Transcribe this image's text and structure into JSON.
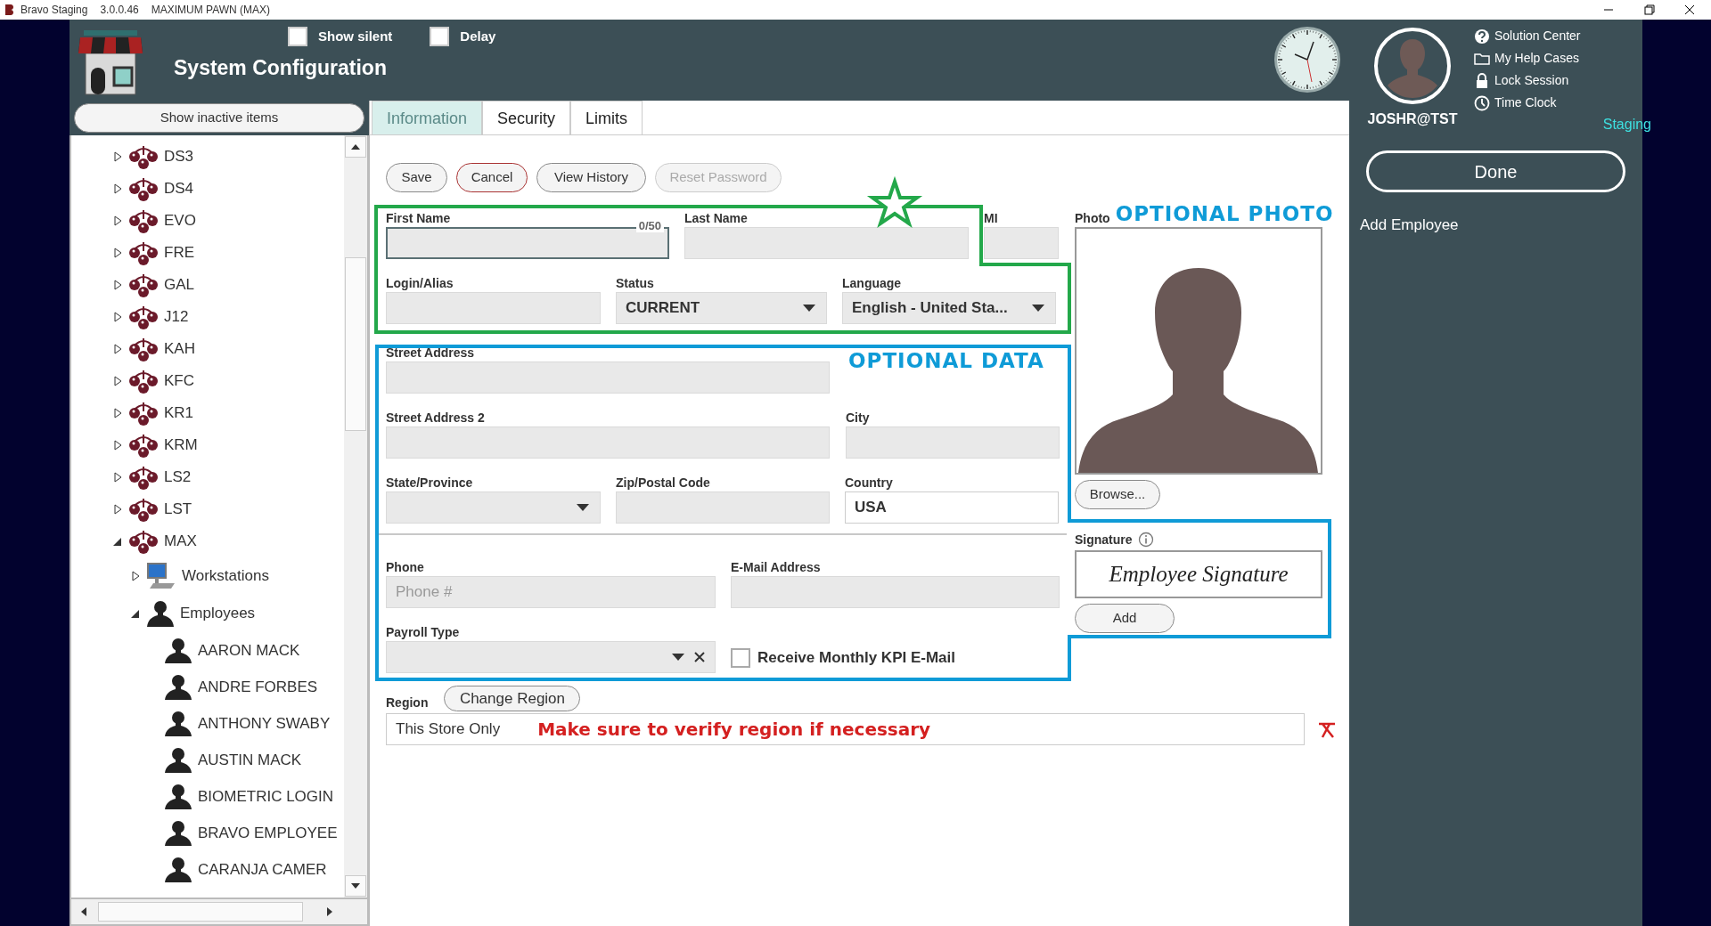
{
  "title_bar": {
    "app": "Bravo Staging",
    "version": "3.0.0.46",
    "store": "MAXIMUM PAWN (MAX)"
  },
  "header": {
    "title": "System Configuration",
    "options": [
      {
        "label": "Show silent",
        "checked": false
      },
      {
        "label": "Delay",
        "checked": false
      }
    ]
  },
  "user": {
    "name": "JOSHR@TST",
    "environment": "Staging",
    "links": [
      {
        "label": "Solution Center",
        "kind": "help"
      },
      {
        "label": "My Help Cases",
        "kind": "folder"
      },
      {
        "label": "Lock Session",
        "kind": "lock"
      },
      {
        "label": "Time Clock",
        "kind": "clock"
      }
    ]
  },
  "right_panel": {
    "done": "Done",
    "context": "Add Employee"
  },
  "sidebar": {
    "toggle": "Show inactive items",
    "tree": [
      {
        "label": "DS3",
        "kind": "store",
        "expanded": false
      },
      {
        "label": "DS4",
        "kind": "store",
        "expanded": false
      },
      {
        "label": "EVO",
        "kind": "store",
        "expanded": false
      },
      {
        "label": "FRE",
        "kind": "store",
        "expanded": false
      },
      {
        "label": "GAL",
        "kind": "store",
        "expanded": false
      },
      {
        "label": "J12",
        "kind": "store",
        "expanded": false
      },
      {
        "label": "KAH",
        "kind": "store",
        "expanded": false
      },
      {
        "label": "KFC",
        "kind": "store",
        "expanded": false
      },
      {
        "label": "KR1",
        "kind": "store",
        "expanded": false
      },
      {
        "label": "KRM",
        "kind": "store",
        "expanded": false
      },
      {
        "label": "LS2",
        "kind": "store",
        "expanded": false
      },
      {
        "label": "LST",
        "kind": "store",
        "expanded": false
      },
      {
        "label": "MAX",
        "kind": "store",
        "expanded": true,
        "children": [
          {
            "label": "Workstations",
            "kind": "workstations",
            "expanded": false
          },
          {
            "label": "Employees",
            "kind": "employees",
            "expanded": true,
            "children": [
              {
                "label": "AARON MACK",
                "kind": "employee"
              },
              {
                "label": "ANDRE FORBES",
                "kind": "employee"
              },
              {
                "label": "ANTHONY SWABY",
                "kind": "employee"
              },
              {
                "label": "AUSTIN MACK",
                "kind": "employee"
              },
              {
                "label": "BIOMETRIC LOGIN",
                "kind": "employee"
              },
              {
                "label": "BRAVO EMPLOYEE",
                "kind": "employee"
              },
              {
                "label": "CARANJA CAMER",
                "kind": "employee"
              }
            ]
          }
        ]
      }
    ]
  },
  "tabs": [
    {
      "label": "Information",
      "selected": true
    },
    {
      "label": "Security",
      "selected": false
    },
    {
      "label": "Limits",
      "selected": false
    }
  ],
  "actions": [
    {
      "label": "Save",
      "kind": "plain",
      "disabled": false
    },
    {
      "label": "Cancel",
      "kind": "cancel",
      "disabled": false
    },
    {
      "label": "View History",
      "kind": "plain",
      "disabled": false
    },
    {
      "label": "Reset Password",
      "kind": "plain",
      "disabled": true
    }
  ],
  "form_rows": [
    [
      {
        "label": "First Name",
        "kind": "text",
        "focused": true,
        "counter": "0/50"
      },
      {
        "label": "Last Name",
        "kind": "text",
        "focused": false
      },
      {
        "label": "MI",
        "kind": "text",
        "focused": false
      }
    ],
    [
      {
        "label": "Login/Alias",
        "kind": "text",
        "focused": false
      },
      {
        "label": "Status",
        "kind": "select",
        "value": "CURRENT"
      },
      {
        "label": "Language",
        "kind": "select",
        "value": "English - United Sta..."
      }
    ],
    [
      {
        "label": "Street Address",
        "kind": "text",
        "focused": false
      }
    ],
    [
      {
        "label": "Street Address 2",
        "kind": "text",
        "focused": false
      },
      {
        "label": "City",
        "kind": "text",
        "focused": false
      }
    ],
    [
      {
        "label": "State/Province",
        "kind": "select"
      },
      {
        "label": "Zip/Postal Code",
        "kind": "text",
        "focused": false
      },
      {
        "label": "Country",
        "kind": "filled",
        "value": "USA"
      }
    ],
    [
      {
        "label": "Phone",
        "kind": "text",
        "focused": false,
        "placeholder": "Phone #"
      },
      {
        "label": "E-Mail Address",
        "kind": "text",
        "focused": false
      }
    ],
    [
      {
        "label": "Payroll Type",
        "kind": "clearable"
      },
      {
        "label": "Receive Monthly KPI E-Mail",
        "kind": "checkbox",
        "checked": false
      }
    ]
  ],
  "photo": {
    "label": "Photo",
    "button": "Browse..."
  },
  "signature": {
    "label": "Signature",
    "sample": "Employee Signature",
    "button": "Add"
  },
  "region": {
    "label": "Region",
    "button": "Change Region",
    "value": "This Store Only"
  },
  "annotations": {
    "photo": "OPTIONAL PHOTO",
    "data": "OPTIONAL DATA",
    "region": "Make sure to verify region if necessary"
  }
}
